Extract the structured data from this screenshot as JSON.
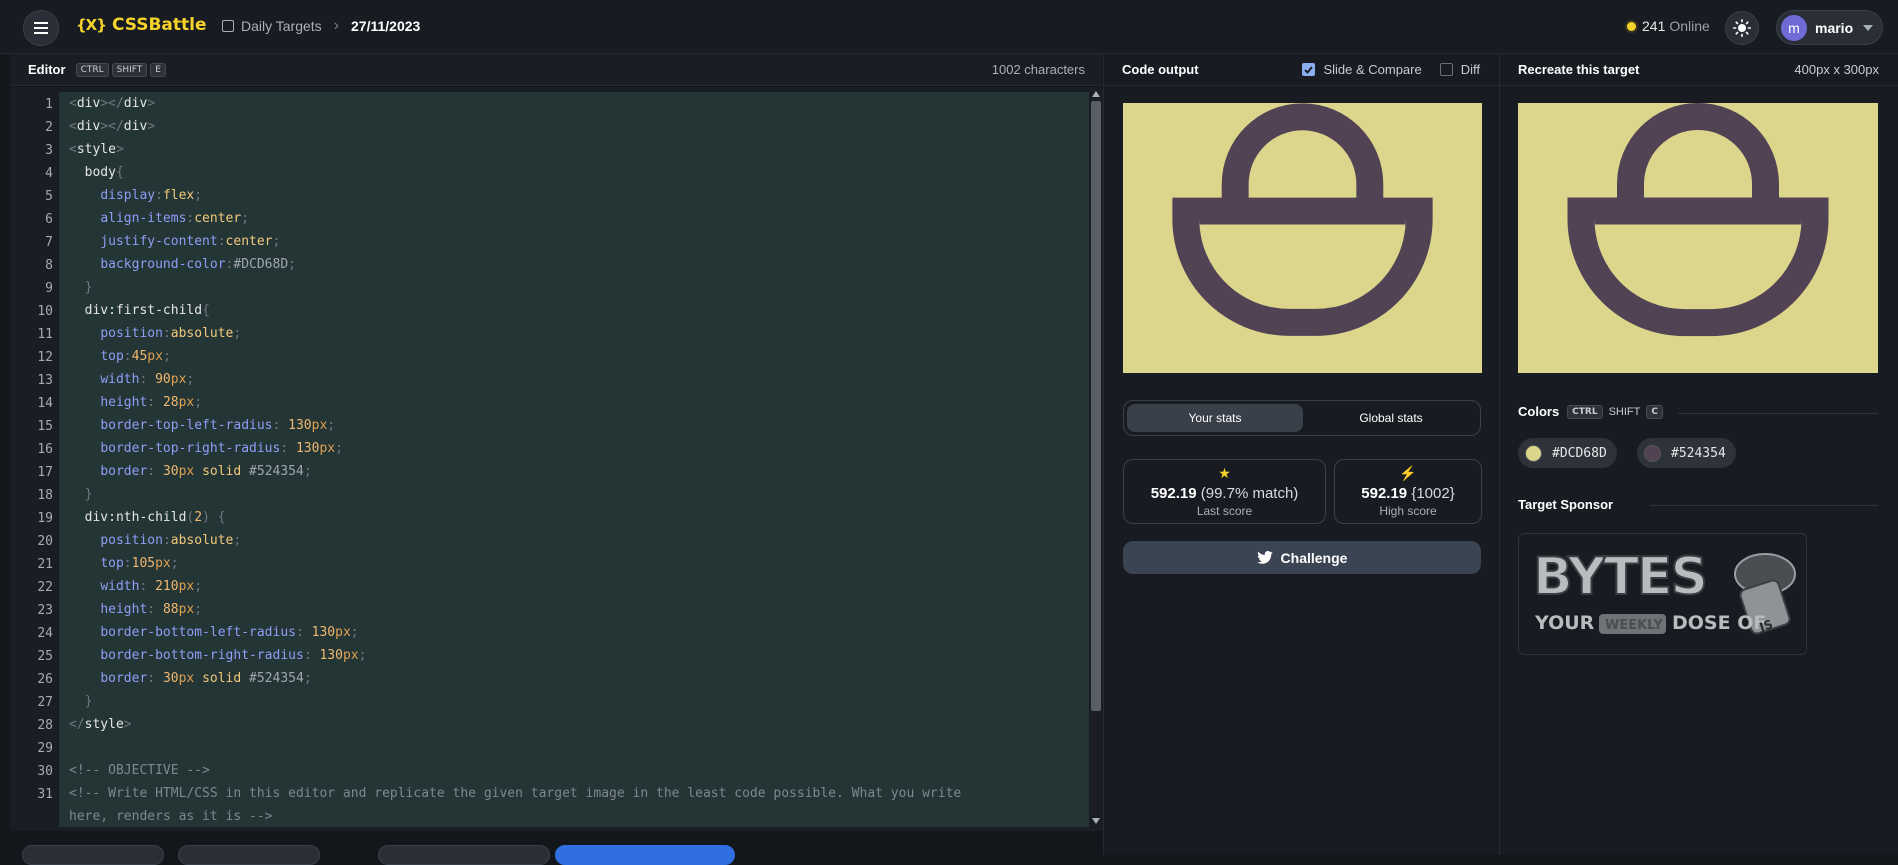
{
  "header": {
    "logo_mark": "{X}",
    "logo_text": "CSSBattle",
    "breadcrumb_section": "Daily Targets",
    "breadcrumb_separator": ">",
    "breadcrumb_date": "27/11/2023",
    "online_count": "241",
    "online_label": "Online",
    "user_initial": "m",
    "user_name": "mario"
  },
  "editor": {
    "title": "Editor",
    "shortcut": [
      "CTRL",
      "SHIFT",
      "E"
    ],
    "char_count": "1002 characters",
    "line_numbers": [
      "1",
      "2",
      "3",
      "4",
      "5",
      "6",
      "7",
      "8",
      "9",
      "10",
      "11",
      "12",
      "13",
      "14",
      "15",
      "16",
      "17",
      "18",
      "19",
      "20",
      "21",
      "22",
      "23",
      "24",
      "25",
      "26",
      "27",
      "28",
      "29",
      "30",
      "31"
    ],
    "code": {
      "l1_a": "<",
      "l1_b": "div",
      "l1_c": "></",
      "l1_d": "div",
      "l1_e": ">",
      "l3_tag": "style",
      "l4_sel": "body",
      "l4_brace": "{",
      "p_display": "display",
      "v_flex": "flex",
      "p_align": "align-items",
      "v_center": "center",
      "p_justify": "justify-content",
      "p_bg": "background-color",
      "v_bg": "#DCD68D",
      "close_brace": "}",
      "l10_sel": "div",
      "l10_pseudo": ":first-child",
      "p_position": "position",
      "v_absolute": "absolute",
      "p_top": "top",
      "v_top1": "45",
      "v_top2": "105",
      "unit_px": "px",
      "p_width": "width",
      "v_w1": "90",
      "v_w2": "210",
      "p_height": "height",
      "v_h1": "28",
      "v_h2": "88",
      "p_btl": "border-top-left-radius",
      "p_btr": "border-top-right-radius",
      "p_bbl": "border-bottom-left-radius",
      "p_bbr": "border-bottom-right-radius",
      "v_130": "130",
      "p_border": "border",
      "v_30": "30",
      "v_solid": "solid",
      "v_hex2": "#524354",
      "l19_pseudo": ":nth-child",
      "l19_arg": "2",
      "comment_objective": "<!-- OBJECTIVE -->",
      "comment_write_1": "<!-- Write HTML/CSS in this editor and replicate the given target image in the least code possible. What you write",
      "comment_write_2": "here, renders as it is -->"
    }
  },
  "output": {
    "title": "Code output",
    "slide_compare_label": "Slide & Compare",
    "slide_compare_checked": true,
    "diff_label": "Diff",
    "diff_checked": false,
    "stats_tabs": [
      "Your stats",
      "Global stats"
    ],
    "last_score_value": "592.19",
    "last_score_match": "(99.7% match)",
    "last_score_label": "Last score",
    "high_score_value": "592.19",
    "high_score_chars": "{1002}",
    "high_score_label": "High score",
    "challenge_label": "Challenge"
  },
  "target": {
    "title": "Recreate this target",
    "dimensions": "400px x 300px",
    "colors_title": "Colors",
    "colors_shortcut": [
      "CTRL",
      "SHIFT",
      "C"
    ],
    "colors": [
      {
        "hex": "#DCD68D",
        "label": "#DCD68D"
      },
      {
        "hex": "#524354",
        "label": "#524354"
      }
    ],
    "sponsor_title": "Target Sponsor",
    "sponsor_word": "BYTES",
    "sponsor_tag_1": "YOUR",
    "sponsor_tag_2": "WEEKLY",
    "sponsor_tag_3": "DOSE OF",
    "sponsor_js": "JS"
  },
  "colors": {
    "background": "#13171c",
    "accent": "#f5d32b",
    "shape": "#524354",
    "canvas": "#DCD68D"
  }
}
